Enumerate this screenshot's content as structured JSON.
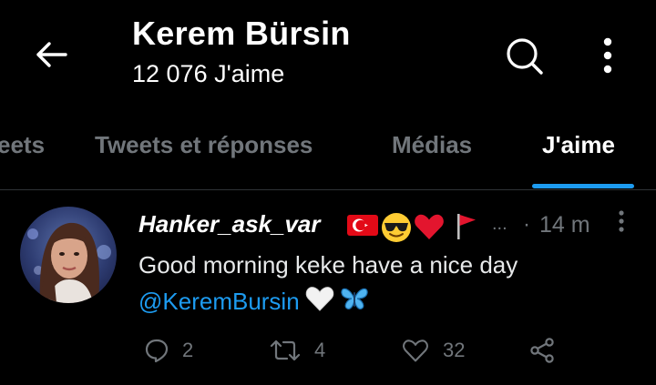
{
  "header": {
    "title": "Kerem Bürsin",
    "subtitle": "12 076 J'aime"
  },
  "tabs": [
    {
      "label": "eets"
    },
    {
      "label": "Tweets et réponses"
    },
    {
      "label": "Médias"
    },
    {
      "label": "J'aime",
      "active": true
    }
  ],
  "tweet": {
    "username": "Hanker_ask_var",
    "ellipsis": "...",
    "separator": "·",
    "time": "14 m",
    "text_line1": "Good morning keke have a nice day",
    "mention": "@KeremBursin",
    "reply_count": "2",
    "retweet_count": "4",
    "like_count": "32",
    "username_emojis": [
      "turkey-flag",
      "smiling-face-with-sunglasses",
      "red-heart",
      "triangular-flag"
    ],
    "text_emojis": [
      "white-heart",
      "butterfly"
    ]
  },
  "colors": {
    "background": "#000000",
    "accent": "#1d9bf0",
    "muted": "#71767b",
    "text": "#e7e9ea"
  }
}
